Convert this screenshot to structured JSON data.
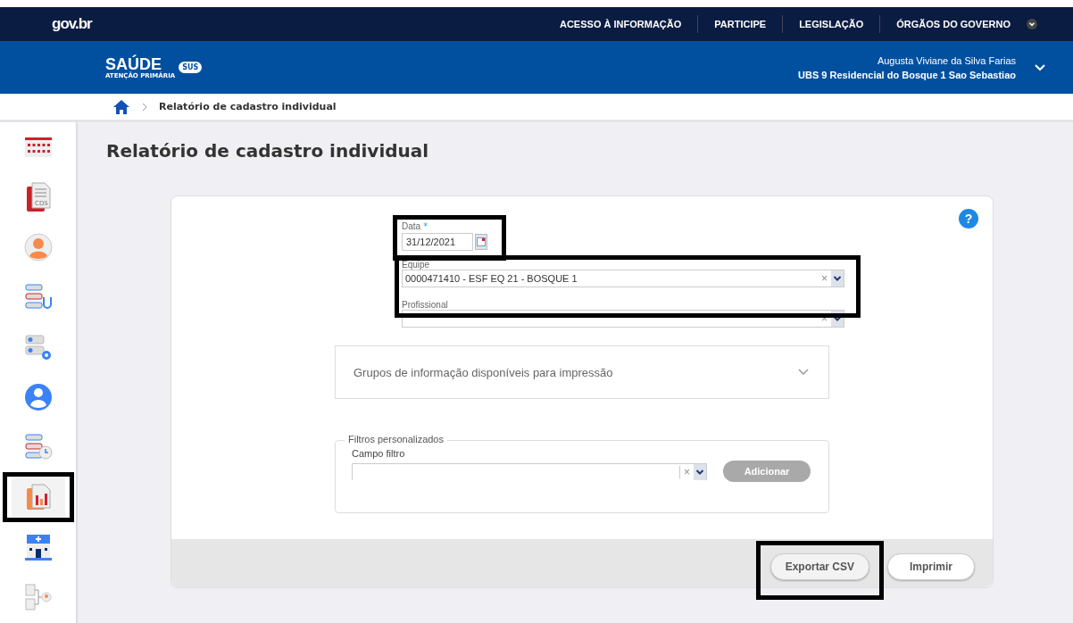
{
  "govbar": {
    "logo": "gov.br",
    "links": [
      "ACESSO À INFORMAÇÃO",
      "PARTICIPE",
      "LEGISLAÇÃO",
      "ÓRGÃOS DO GOVERNO"
    ]
  },
  "header": {
    "logo_title": "SAÚDE",
    "logo_subtitle": "ATENÇÃO PRIMÁRIA",
    "logo_badge": "SUS",
    "user_name": "Augusta Viviane da Silva Farias",
    "unit": "UBS 9 Residencial do Bosque 1 Sao Sebastiao"
  },
  "breadcrumb": {
    "current": "Relatório de cadastro individual"
  },
  "sidebar": {
    "items": [
      {
        "kind": "calendar",
        "selected": false,
        "highlighted": false
      },
      {
        "kind": "cds",
        "label": "CDS",
        "selected": false,
        "highlighted": false
      },
      {
        "kind": "person",
        "selected": false,
        "highlighted": false
      },
      {
        "kind": "stethoscope",
        "selected": false,
        "highlighted": false
      },
      {
        "kind": "settings",
        "selected": false,
        "highlighted": false
      },
      {
        "kind": "doctor",
        "selected": false,
        "highlighted": false
      },
      {
        "kind": "clock",
        "selected": false,
        "highlighted": false
      },
      {
        "kind": "report",
        "selected": true,
        "highlighted": true
      },
      {
        "kind": "hospital",
        "selected": false,
        "highlighted": false
      },
      {
        "kind": "tree",
        "selected": false,
        "highlighted": false
      }
    ]
  },
  "page": {
    "title": "Relatório de cadastro individual",
    "help": "?"
  },
  "form": {
    "date": {
      "label": "Data",
      "required_mark": "*",
      "value": "31/12/2021",
      "highlighted": true
    },
    "team": {
      "label": "Equipe",
      "value": "0000471410 - ESF EQ 21 - BOSQUE 1",
      "clear": "×",
      "highlighted": true
    },
    "professional": {
      "label": "Profissional",
      "clear": "×"
    },
    "groups": {
      "label": "Grupos de informação disponíveis para impressão",
      "expanded": false
    },
    "filters": {
      "legend": "Filtros personalizados",
      "field_label": "Campo filtro",
      "clear": "×",
      "add_button": {
        "label": "Adicionar",
        "disabled": true
      }
    }
  },
  "footer": {
    "buttons": [
      {
        "label": "Exportar CSV",
        "highlighted": true
      },
      {
        "label": "Imprimir",
        "highlighted": false
      }
    ]
  }
}
